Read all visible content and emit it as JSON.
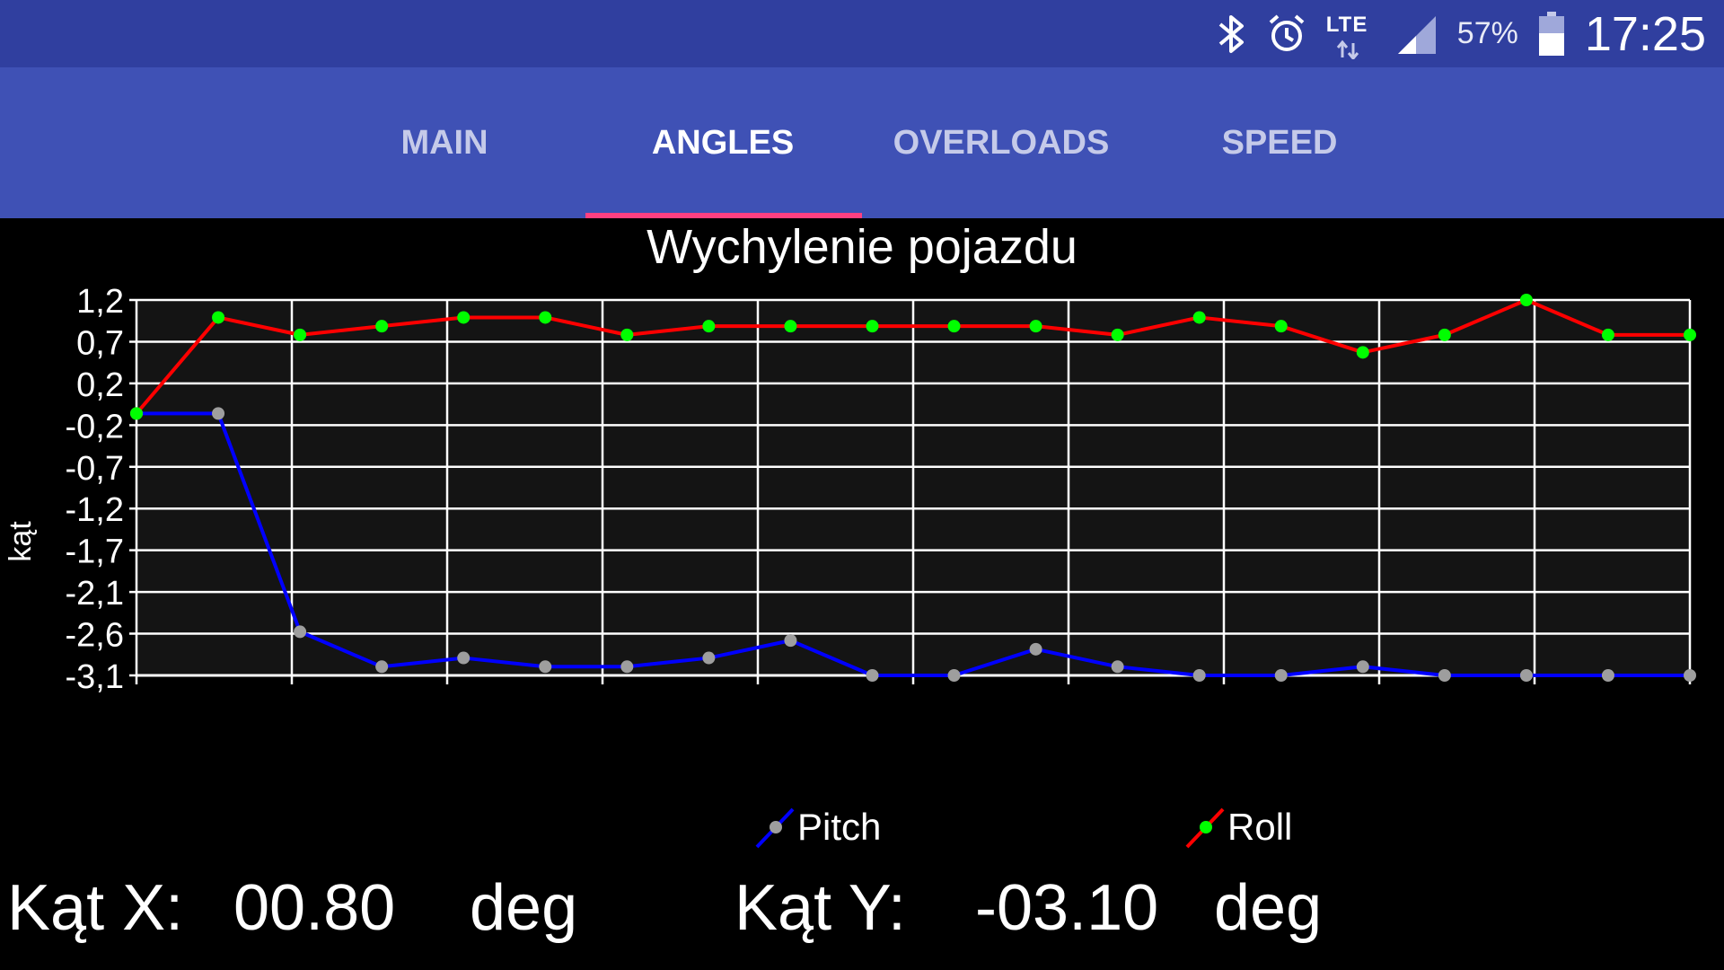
{
  "status_bar": {
    "icons": [
      "bluetooth-icon",
      "alarm-icon",
      "lte-icon",
      "signal-icon",
      "battery-icon"
    ],
    "network": "LTE",
    "battery": "57%",
    "time": "17:25"
  },
  "tabs": [
    {
      "label": "MAIN",
      "active": false
    },
    {
      "label": "ANGLES",
      "active": true
    },
    {
      "label": "OVERLOADS",
      "active": false
    },
    {
      "label": "SPEED",
      "active": false
    }
  ],
  "colors": {
    "status_bar": "#303f9f",
    "tab_bar": "#3f51b5",
    "indicator": "#ff4081",
    "plot_bg": "#141414",
    "pitch_line": "#0000ff",
    "pitch_point": "#9e9e9e",
    "roll_line": "#ff0000",
    "roll_point": "#00ff00"
  },
  "chart_data": {
    "type": "line",
    "title": "Wychylenie pojazdu",
    "ylabel": "kąt",
    "xlabel": "",
    "ylim": [
      -3.1,
      1.2
    ],
    "y_ticks": [
      "1,2",
      "0,7",
      "0,2",
      "-0,2",
      "-0,7",
      "-1,2",
      "-1,7",
      "-2,1",
      "-2,6",
      "-3,1"
    ],
    "grid": true,
    "legend_position": "bottom",
    "series": [
      {
        "name": "Pitch",
        "values": [
          -0.1,
          -0.1,
          -2.6,
          -3.0,
          -2.9,
          -3.0,
          -3.0,
          -2.9,
          -2.7,
          -3.1,
          -3.3,
          -2.8,
          -3.0,
          -3.3,
          -3.3,
          -3.0,
          -3.2,
          -3.2,
          -3.3,
          -3.3
        ]
      },
      {
        "name": "Roll",
        "values": [
          -0.1,
          1.0,
          0.8,
          0.9,
          1.0,
          1.0,
          0.8,
          0.9,
          0.9,
          0.9,
          0.9,
          0.9,
          0.8,
          1.0,
          0.9,
          0.6,
          0.8,
          1.2,
          0.8,
          0.8
        ]
      }
    ]
  },
  "readouts": {
    "x_label": "Kąt X:",
    "x_value": "00.80",
    "x_unit": "deg",
    "y_label": "Kąt Y:",
    "y_value": "-03.10",
    "y_unit": "deg"
  }
}
